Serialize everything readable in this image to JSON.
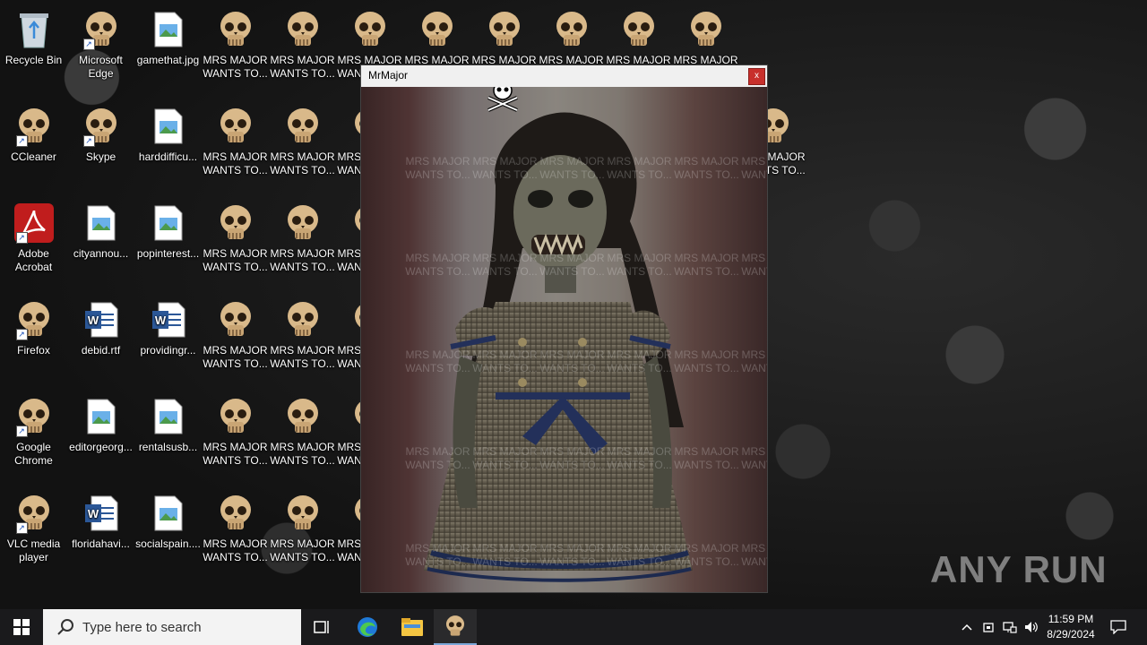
{
  "desktop": {
    "icons": [
      {
        "label": "Recycle Bin",
        "kind": "recycle-bin-icon",
        "shortcut": false
      },
      {
        "label": "Microsoft\nEdge",
        "kind": "skull-icon",
        "shortcut": true
      },
      {
        "label": "gamethat.jpg",
        "kind": "image-file-icon",
        "shortcut": false
      },
      {
        "label": "MRS MAJOR\nWANTS TO...",
        "kind": "skull-icon",
        "shortcut": false
      },
      {
        "label": "MRS MAJOR\nWANTS TO...",
        "kind": "skull-icon",
        "shortcut": false
      },
      {
        "label": "MRS MAJOR\nWANTS TO...",
        "kind": "skull-icon",
        "shortcut": false
      },
      {
        "label": "MRS MAJOR\nWANTS TO...",
        "kind": "skull-icon",
        "shortcut": false
      },
      {
        "label": "MRS MAJOR\nWANTS TO...",
        "kind": "skull-icon",
        "shortcut": false
      },
      {
        "label": "MRS MAJOR\nWANTS TO...",
        "kind": "skull-icon",
        "shortcut": false
      },
      {
        "label": "MRS MAJOR\nWANTS TO...",
        "kind": "skull-icon",
        "shortcut": false
      },
      {
        "label": "MRS MAJOR\nWANTS TO...",
        "kind": "skull-icon",
        "shortcut": false
      },
      {
        "label": "MRS MAJOR\nWANTS TO...",
        "kind": "skull-icon",
        "shortcut": false
      },
      {
        "label": "CCleaner",
        "kind": "skull-icon",
        "shortcut": true
      },
      {
        "label": "Skype",
        "kind": "skull-icon",
        "shortcut": true
      },
      {
        "label": "harddifficu...",
        "kind": "image-file-icon",
        "shortcut": false
      },
      {
        "label": "MRS MAJOR\nWANTS TO...",
        "kind": "skull-icon",
        "shortcut": false
      },
      {
        "label": "MRS MAJOR\nWANTS TO...",
        "kind": "skull-icon",
        "shortcut": false
      },
      {
        "label": "MRS MAJOR\nWANTS TO...",
        "kind": "skull-icon",
        "shortcut": false
      },
      {
        "label": "MRS MAJOR\nWANTS TO...",
        "kind": "skull-icon",
        "shortcut": false
      },
      {
        "label": "Adobe\nAcrobat",
        "kind": "acrobat-icon",
        "shortcut": true
      },
      {
        "label": "cityannou...",
        "kind": "image-file-icon",
        "shortcut": false
      },
      {
        "label": "popinterest...",
        "kind": "image-file-icon",
        "shortcut": false
      },
      {
        "label": "MRS MAJOR\nWANTS TO...",
        "kind": "skull-icon",
        "shortcut": false
      },
      {
        "label": "MRS MAJOR\nWANTS TO...",
        "kind": "skull-icon",
        "shortcut": false
      },
      {
        "label": "MRS MAJOR\nWANTS TO...",
        "kind": "skull-icon",
        "shortcut": false
      },
      {
        "label": "Firefox",
        "kind": "skull-icon",
        "shortcut": true
      },
      {
        "label": "debid.rtf",
        "kind": "word-doc-icon",
        "shortcut": false
      },
      {
        "label": "providingr...",
        "kind": "word-doc-icon",
        "shortcut": false
      },
      {
        "label": "MRS MAJOR\nWANTS TO...",
        "kind": "skull-icon",
        "shortcut": false
      },
      {
        "label": "MRS MAJOR\nWANTS TO...",
        "kind": "skull-icon",
        "shortcut": false
      },
      {
        "label": "MRS MAJOR\nWANTS TO...",
        "kind": "skull-icon",
        "shortcut": false
      },
      {
        "label": "Google\nChrome",
        "kind": "skull-icon",
        "shortcut": true
      },
      {
        "label": "editorgeorg...",
        "kind": "image-file-icon",
        "shortcut": false
      },
      {
        "label": "rentalsusb...",
        "kind": "image-file-icon",
        "shortcut": false
      },
      {
        "label": "MRS MAJOR\nWANTS TO...",
        "kind": "skull-icon",
        "shortcut": false
      },
      {
        "label": "MRS MAJOR\nWANTS TO...",
        "kind": "skull-icon",
        "shortcut": false
      },
      {
        "label": "MRS MAJOR\nWANTS TO...",
        "kind": "skull-icon",
        "shortcut": false
      },
      {
        "label": "VLC media\nplayer",
        "kind": "skull-icon",
        "shortcut": true
      },
      {
        "label": "floridahavi...",
        "kind": "word-doc-icon",
        "shortcut": false
      },
      {
        "label": "socialspain....",
        "kind": "image-file-icon",
        "shortcut": false
      },
      {
        "label": "MRS MAJOR\nWANTS TO...",
        "kind": "skull-icon",
        "shortcut": false
      },
      {
        "label": "MRS MAJOR\nWANTS TO...",
        "kind": "skull-icon",
        "shortcut": false
      },
      {
        "label": "MRS MAJOR\nWANTS TO...",
        "kind": "skull-icon",
        "shortcut": false
      }
    ],
    "ghost_label": "MRS MAJOR\nWANTS TO..."
  },
  "window": {
    "title": "MrMajor",
    "close_label": "x"
  },
  "taskbar": {
    "search_placeholder": "Type here to search",
    "apps": [
      "task-view-icon",
      "edge-icon",
      "file-explorer-icon",
      "skull-app-icon"
    ],
    "tray_icons": [
      "chevron-up-icon",
      "usb-icon",
      "network-icon",
      "volume-icon"
    ],
    "time": "11:59 PM",
    "date": "8/29/2024"
  },
  "watermark": "ANY RUN",
  "colors": {
    "taskbar": "#1a1a1c",
    "close_button": "#c8302c",
    "skull": "#d9b98a"
  }
}
